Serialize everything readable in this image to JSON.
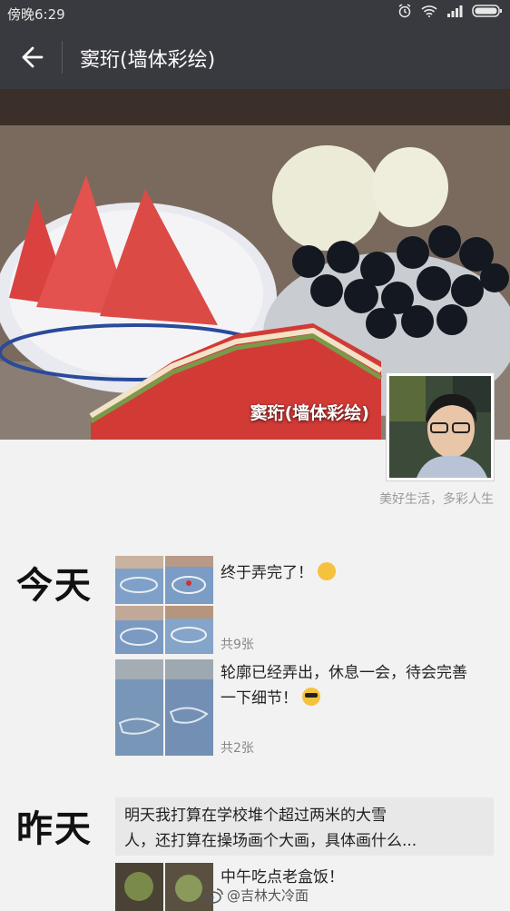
{
  "status_bar": {
    "time": "傍晚6:29"
  },
  "header": {
    "title": "窦珩(墙体彩绘)"
  },
  "profile": {
    "cover_name": "窦珩(墙体彩绘)",
    "signature": "美好生活，多彩人生"
  },
  "days": [
    {
      "label": "今天",
      "posts": [
        {
          "text": "终于弄完了！",
          "count": "共9张"
        },
        {
          "text_line1": "轮廓已经弄出，休息一会，待会完善",
          "text_line2": "一下细节！",
          "count": "共2张"
        }
      ]
    },
    {
      "label": "昨天",
      "posts": [
        {
          "text_line1": "明天我打算在学校堆个超过两米的大雪",
          "text_line2": "人，还打算在操场画个大画，具体画什么..."
        },
        {
          "text": "中午吃点老盒饭！"
        }
      ]
    }
  ],
  "watermark": {
    "text": "@吉林大冷面"
  }
}
